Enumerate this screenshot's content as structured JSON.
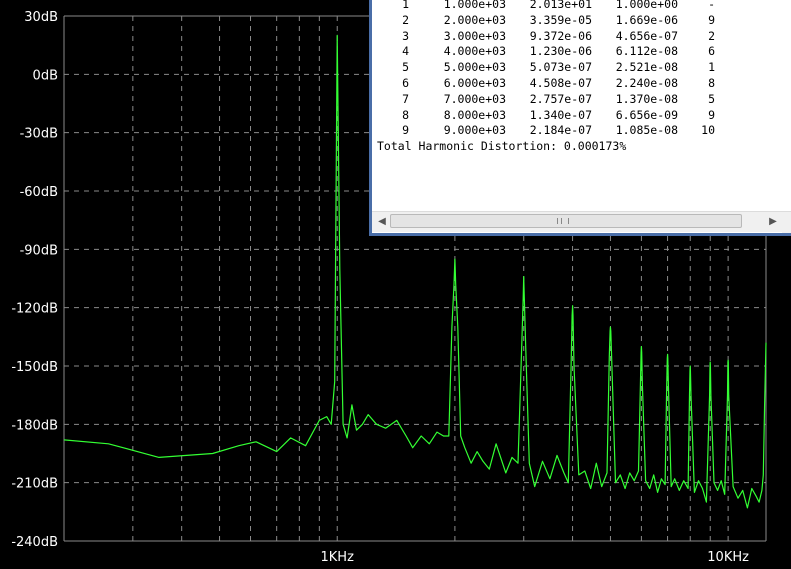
{
  "chart_data": {
    "type": "line",
    "xscale": "log",
    "xlim": [
      200,
      12500
    ],
    "ylim": [
      -240,
      30
    ],
    "yticks": [
      30,
      0,
      -30,
      -60,
      -90,
      -120,
      -150,
      -180,
      -210,
      -240
    ],
    "ytick_labels": [
      "30dB",
      "0dB",
      "-30dB",
      "-60dB",
      "-90dB",
      "-120dB",
      "-150dB",
      "-180dB",
      "-210dB",
      "-240dB"
    ],
    "xtick_labels": [
      {
        "value": 1000,
        "label": "1KHz"
      },
      {
        "value": 10000,
        "label": "10KHz"
      }
    ],
    "grid": true,
    "series": [
      {
        "color": "#33ff33",
        "x": [
          200,
          260,
          350,
          480,
          560,
          620,
          700,
          760,
          830,
          900,
          940,
          965,
          985,
          1000,
          1015,
          1035,
          1060,
          1090,
          1120,
          1160,
          1200,
          1260,
          1330,
          1420,
          1500,
          1560,
          1640,
          1720,
          1800,
          1870,
          1930,
          1965,
          1990,
          2000,
          2010,
          2035,
          2070,
          2120,
          2200,
          2280,
          2360,
          2450,
          2550,
          2700,
          2800,
          2900,
          2965,
          2990,
          3000,
          3010,
          3035,
          3100,
          3200,
          3350,
          3500,
          3650,
          3800,
          3900,
          3965,
          3990,
          4000,
          4010,
          4035,
          4150,
          4300,
          4450,
          4600,
          4750,
          4900,
          4965,
          4990,
          5000,
          5010,
          5035,
          5150,
          5300,
          5450,
          5600,
          5750,
          5900,
          5965,
          5990,
          6000,
          6010,
          6035,
          6150,
          6300,
          6450,
          6600,
          6750,
          6900,
          6965,
          6990,
          7000,
          7010,
          7035,
          7150,
          7300,
          7500,
          7700,
          7900,
          7965,
          7990,
          8000,
          8010,
          8035,
          8200,
          8400,
          8600,
          8800,
          8965,
          8990,
          9000,
          9010,
          9035,
          9200,
          9400,
          9600,
          9800,
          9965,
          9990,
          10000,
          10010,
          10035,
          10300,
          10600,
          10900,
          11200,
          11500,
          11800,
          12000,
          12200,
          12300,
          12400,
          12500
        ],
        "y": [
          -188,
          -190,
          -197,
          -195,
          -191,
          -189,
          -194,
          -187,
          -191,
          -178,
          -176,
          -180,
          -158,
          20,
          -100,
          -180,
          -187,
          -170,
          -183,
          -180,
          -175,
          -180,
          -182,
          -178,
          -186,
          -192,
          -186,
          -190,
          -184,
          -186,
          -186,
          -130,
          -108,
          -95,
          -108,
          -130,
          -186,
          -192,
          -200,
          -194,
          -199,
          -203,
          -190,
          -205,
          -197,
          -200,
          -140,
          -115,
          -104,
          -115,
          -140,
          -200,
          -212,
          -199,
          -208,
          -196,
          -205,
          -210,
          -150,
          -124,
          -119,
          -124,
          -150,
          -206,
          -204,
          -213,
          -200,
          -212,
          -205,
          -145,
          -132,
          -130,
          -132,
          -145,
          -210,
          -206,
          -213,
          -205,
          -209,
          -204,
          -160,
          -143,
          -140,
          -143,
          -160,
          -209,
          -213,
          -206,
          -215,
          -208,
          -211,
          -160,
          -146,
          -144,
          -146,
          -160,
          -212,
          -208,
          -214,
          -209,
          -213,
          -165,
          -152,
          -150,
          -152,
          -165,
          -215,
          -209,
          -213,
          -220,
          -165,
          -150,
          -148,
          -150,
          -165,
          -210,
          -214,
          -209,
          -216,
          -165,
          -148,
          -147,
          -148,
          -165,
          -212,
          -218,
          -214,
          -223,
          -213,
          -217,
          -220,
          -214,
          -206,
          -170,
          -138
        ]
      }
    ]
  },
  "fourier": {
    "rows": [
      {
        "n": "1",
        "freq": "1.000e+03",
        "amp": "2.013e+01",
        "namp": "1.000e+00",
        "phase": "-"
      },
      {
        "n": "2",
        "freq": "2.000e+03",
        "amp": "3.359e-05",
        "namp": "1.669e-06",
        "phase": "9"
      },
      {
        "n": "3",
        "freq": "3.000e+03",
        "amp": "9.372e-06",
        "namp": "4.656e-07",
        "phase": "2"
      },
      {
        "n": "4",
        "freq": "4.000e+03",
        "amp": "1.230e-06",
        "namp": "6.112e-08",
        "phase": "6"
      },
      {
        "n": "5",
        "freq": "5.000e+03",
        "amp": "5.073e-07",
        "namp": "2.521e-08",
        "phase": "1"
      },
      {
        "n": "6",
        "freq": "6.000e+03",
        "amp": "4.508e-07",
        "namp": "2.240e-08",
        "phase": "8"
      },
      {
        "n": "7",
        "freq": "7.000e+03",
        "amp": "2.757e-07",
        "namp": "1.370e-08",
        "phase": "5"
      },
      {
        "n": "8",
        "freq": "8.000e+03",
        "amp": "1.340e-07",
        "namp": "6.656e-09",
        "phase": "9"
      },
      {
        "n": "9",
        "freq": "9.000e+03",
        "amp": "2.184e-07",
        "namp": "1.085e-08",
        "phase": "10"
      }
    ],
    "thd": "Total Harmonic Distortion: 0.000173%"
  },
  "colors": {
    "plot_bg": "#000000",
    "grid": "#8a8a8a",
    "trace": "#33ff33",
    "window_border": "#4a6ea8"
  }
}
